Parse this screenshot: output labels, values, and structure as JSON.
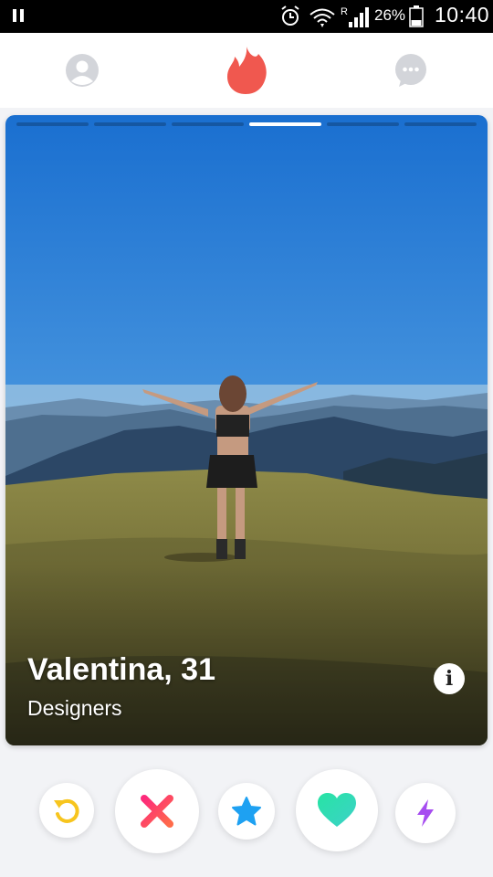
{
  "status_bar": {
    "battery": "26%",
    "time": "10:40",
    "network_label": "R",
    "icons": [
      "pause-icon",
      "alarm-icon",
      "wifi-icon",
      "signal-icon",
      "battery-icon"
    ]
  },
  "nav": {
    "left_icon": "profile-icon",
    "center_icon": "flame-logo",
    "right_icon": "chat-icon",
    "flame_color": "#f0584f"
  },
  "card": {
    "name_age": "Valentina, 31",
    "job": "Designers",
    "info_label": "i",
    "photo_count": 6,
    "active_photo": 3
  },
  "actions": [
    {
      "icon": "rewind-icon",
      "color": "#f7c51e"
    },
    {
      "icon": "nope-icon",
      "color": "#fd4e5a"
    },
    {
      "icon": "super-like-icon",
      "color": "#1ea1f2"
    },
    {
      "icon": "like-icon",
      "color": "#2ee3b5"
    },
    {
      "icon": "boost-icon",
      "color": "#a64cf0"
    }
  ]
}
